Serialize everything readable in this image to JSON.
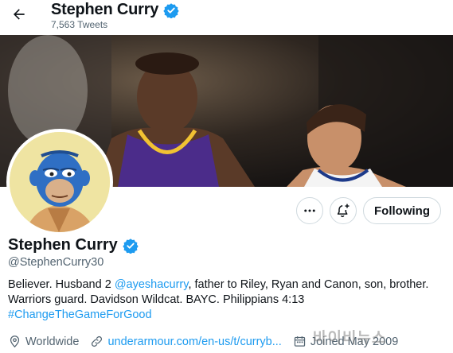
{
  "header": {
    "name": "Stephen Curry",
    "tweet_count": "7,563 Tweets"
  },
  "profile": {
    "display_name": "Stephen Curry",
    "handle": "@StephenCurry30",
    "bio": {
      "line1_prefix": "Believer. Husband 2 ",
      "mention": "@ayeshacurry",
      "line1_suffix": ", father to Riley, Ryan and Canon, son, brother.",
      "line2": "Warriors guard. Davidson Wildcat. BAYC. Philippians 4:13",
      "hashtag": "#ChangeTheGameForGood"
    },
    "location": "Worldwide",
    "website": "underarmour.com/en-us/t/curryb...",
    "joined": "Joined May 2009"
  },
  "actions": {
    "more_label": "More",
    "notify_label": "Notifications",
    "follow_label": "Following"
  },
  "watermark": "바이비뉴스",
  "colors": {
    "accent": "#1d9bf0",
    "verified": "#1d9bf0",
    "text_primary": "#0f1419",
    "text_secondary": "#536471",
    "border": "#cfd9de"
  },
  "icons": [
    "back-arrow-icon",
    "verified-badge-icon",
    "more-icon",
    "bell-plus-icon",
    "location-icon",
    "link-icon",
    "calendar-icon"
  ]
}
